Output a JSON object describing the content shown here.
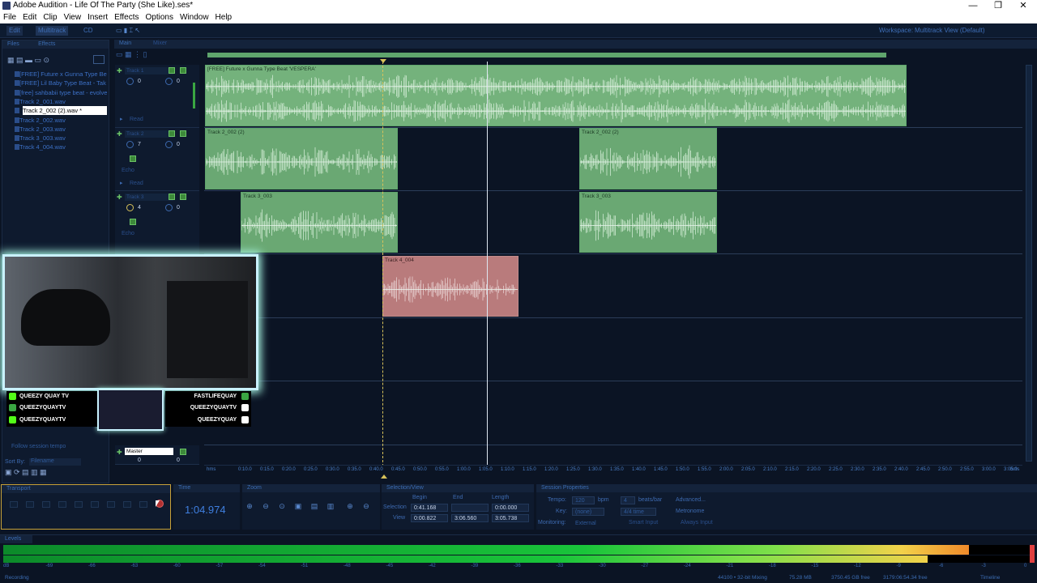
{
  "window": {
    "title": "Adobe Audition - Life Of The Party (She Like).ses*",
    "minimize": "—",
    "maximize": "❐",
    "close": "✕"
  },
  "menu": [
    "File",
    "Edit",
    "Clip",
    "View",
    "Insert",
    "Effects",
    "Options",
    "Window",
    "Help"
  ],
  "toolbar": {
    "edit": "Edit",
    "multitrack": "Multitrack",
    "cd": "CD",
    "workspace_label": "Workspace:",
    "workspace_value": "Multitrack View (Default)"
  },
  "files_panel": {
    "tab_files": "Files",
    "tab_effects": "Effects",
    "files": [
      "[FREE] Future x Gunna Type Be",
      "[FREE] Lil Baby Type Beat - Tak",
      "[free] sahbabii type beat - evolve",
      "Track 2_001.wav",
      "Track 2_002 (2).wav *",
      "Track 2_002.wav",
      "Track 2_003.wav",
      "Track 3_003.wav",
      "Track 4_004.wav"
    ],
    "selected_index": 4,
    "sort_by_label": "Sort By:",
    "sort_by_value": "Filename",
    "follow_tempo": "Follow session tempo"
  },
  "editor": {
    "tab_main": "Main",
    "tab_mixer": "Mixer",
    "tracks": [
      {
        "name": "Track 1",
        "vol": "0",
        "pan": "0",
        "read": "Read"
      },
      {
        "name": "Track 2",
        "vol": "7",
        "pan": "0",
        "fx": "Echo",
        "read": "Read"
      },
      {
        "name": "Track 3",
        "vol": "4",
        "pan": "0",
        "fx": "Echo"
      }
    ],
    "master": {
      "name": "Master",
      "vol": "0",
      "pan": "0"
    },
    "clips": [
      {
        "label": "[FREE] Future x Gunna Type Beat 'VESPERA'",
        "color": "#74b27c"
      },
      {
        "label": "Track 2_002 (2)",
        "color": "#6aa873"
      },
      {
        "label": "Track 2_002 (2)",
        "color": "#6aa873"
      },
      {
        "label": "Track 3_003",
        "color": "#6aa873"
      },
      {
        "label": "Track 3_003",
        "color": "#6aa873"
      },
      {
        "label": "Track 4_004",
        "color": "#b97b7c"
      }
    ],
    "ruler": {
      "start": "hms",
      "end": "hms",
      "ticks": [
        "0:10.0",
        "0:15.0",
        "0:20.0",
        "0:25.0",
        "0:30.0",
        "0:35.0",
        "0:40.0",
        "0:45.0",
        "0:50.0",
        "0:55.0",
        "1:00.0",
        "1:05.0",
        "1:10.0",
        "1:15.0",
        "1:20.0",
        "1:25.0",
        "1:30.0",
        "1:35.0",
        "1:40.0",
        "1:45.0",
        "1:50.0",
        "1:55.0",
        "2:00.0",
        "2:05.0",
        "2:10.0",
        "2:15.0",
        "2:20.0",
        "2:25.0",
        "2:30.0",
        "2:35.0",
        "2:40.0",
        "2:45.0",
        "2:50.0",
        "2:55.0",
        "3:00.0",
        "3:05.0"
      ]
    }
  },
  "webcam": {
    "socials_left": [
      "QUEEZY QUAY TV",
      "QUEEZYQUAYTV",
      "QUEEZYQUAYTV"
    ],
    "socials_right": [
      "FASTLIFEQUAY",
      "QUEEZYQUAYTV",
      "QUEEZYQUAY"
    ],
    "icon_colors": {
      "twitch": "#9146ff",
      "kick": "#53fc18",
      "snap": "#fffc00",
      "tiktok": "#ffffff",
      "x": "#ffffff"
    }
  },
  "transport": {
    "title": "Transport"
  },
  "time": {
    "title": "Time",
    "value": "1:04.974"
  },
  "zoom": {
    "title": "Zoom"
  },
  "selection_view": {
    "title": "Selection/View",
    "col_begin": "Begin",
    "col_end": "End",
    "col_length": "Length",
    "row_selection": "Selection",
    "row_view": "View",
    "sel_begin": "0:41.168",
    "sel_end": "",
    "sel_length": "0:00.000",
    "view_begin": "0:00.822",
    "view_end": "3:06.560",
    "view_length": "3:05.738"
  },
  "session_properties": {
    "title": "Session Properties",
    "tempo_label": "Tempo:",
    "tempo": "120",
    "bpm": "bpm",
    "beats": "4",
    "beats_per_bar": "beats/bar",
    "advanced": "Advanced...",
    "key_label": "Key:",
    "key": "(none)",
    "time_sig": "4/4 time",
    "metronome": "Metronome",
    "monitoring_label": "Monitoring:",
    "monitoring": "External",
    "smart_input": "Smart Input",
    "always_input": "Always Input"
  },
  "levels": {
    "title": "Levels",
    "scale": [
      "dB",
      "-69",
      "-66",
      "-63",
      "-60",
      "-57",
      "-54",
      "-51",
      "-48",
      "-45",
      "-42",
      "-39",
      "-36",
      "-33",
      "-30",
      "-27",
      "-24",
      "-21",
      "-18",
      "-15",
      "-12",
      "-9",
      "-6",
      "-3",
      "0"
    ]
  },
  "status": {
    "left": "Recording",
    "sample": "44100 • 32-bit Mixing",
    "mem": "75.28 MB",
    "disk": "3750.45 GB free",
    "time_free": "3179:06:54.34 free",
    "right": "Timeline"
  }
}
